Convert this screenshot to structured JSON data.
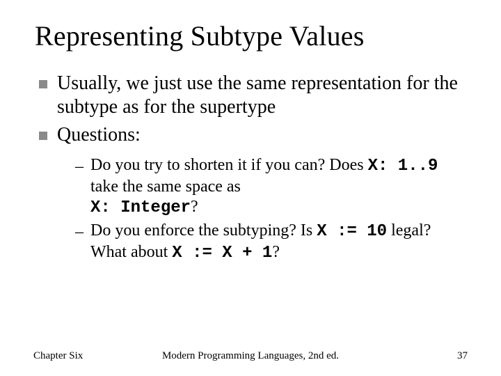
{
  "title": "Representing Subtype Values",
  "bullets": [
    "Usually, we just use the same representation for the subtype as for the supertype",
    "Questions:"
  ],
  "sub": {
    "b0": {
      "p0": "Do you try to shorten it if you can?  Does ",
      "c0": "X: 1..9",
      "p1": " take the same space as ",
      "c1": "X: Integer",
      "p2": "?"
    },
    "b1": {
      "p0": "Do you enforce the subtyping?  Is ",
      "c0": "X := 10",
      "p1": " legal?  What about ",
      "c1": "X := X + 1",
      "p2": "?"
    }
  },
  "footer": {
    "left": "Chapter Six",
    "center": "Modern Programming Languages, 2nd ed.",
    "right": "37"
  }
}
